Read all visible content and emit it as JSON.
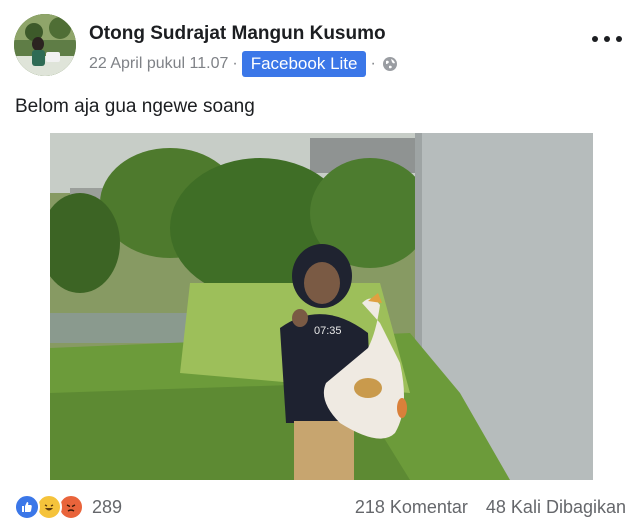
{
  "post": {
    "author": "Otong Sudrajat Mangun Kusumo",
    "timestamp": "22 April pukul 11.07",
    "separator": "·",
    "source_badge": "Facebook Lite",
    "privacy_icon": "globe-icon",
    "menu_icon": "more-dots-icon",
    "text": "Belom aja gua ngewe soang",
    "photo_overlay_text": "07:35"
  },
  "footer": {
    "reaction_icons": [
      "like-reaction-icon",
      "haha-reaction-icon",
      "angry-reaction-icon"
    ],
    "reaction_count": "289",
    "comments": "218 Komentar",
    "shares": "48 Kali Dibagikan"
  },
  "colors": {
    "badge": "#3b77e8",
    "like": "#3b77e8",
    "haha": "#f5c33b",
    "angry": "#e9643b",
    "secondary_text": "#65676b"
  }
}
